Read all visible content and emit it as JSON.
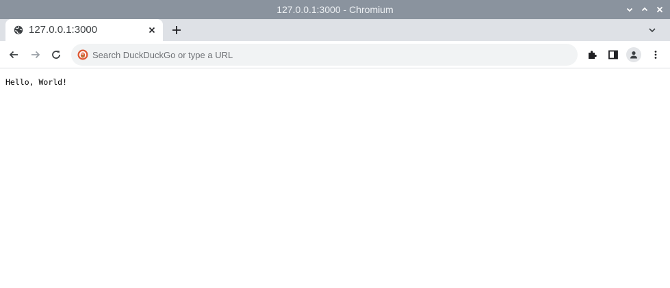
{
  "window": {
    "title": "127.0.0.1:3000 - Chromium"
  },
  "tabs": [
    {
      "title": "127.0.0.1:3000",
      "favicon": "globe-icon",
      "active": true
    }
  ],
  "toolbar": {
    "omnibox_placeholder": "Search DuckDuckGo or type a URL",
    "omnibox_value": "",
    "search_engine_icon": "duckduckgo-icon"
  },
  "page": {
    "body_text": "Hello, World!"
  },
  "colors": {
    "titlebar_bg": "#8a939e",
    "tabstrip_bg": "#dee1e6",
    "omnibox_bg": "#f1f3f4",
    "ddg_orange": "#de5833"
  }
}
